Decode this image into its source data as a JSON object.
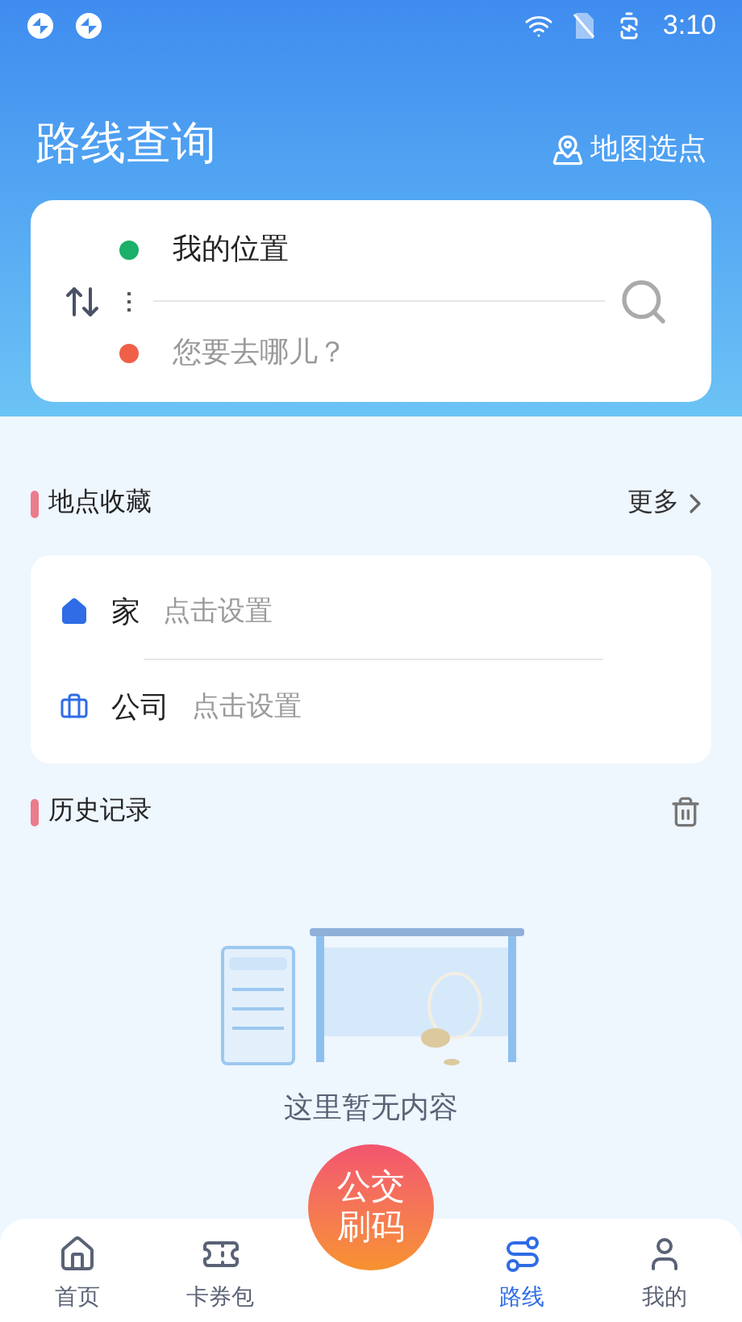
{
  "status_bar": {
    "time": "3:10"
  },
  "header": {
    "title": "路线查询",
    "map_pick": "地图选点"
  },
  "route": {
    "origin": "我的位置",
    "destination_placeholder": "您要去哪儿？"
  },
  "favorites": {
    "title": "地点收藏",
    "more": "更多",
    "items": [
      {
        "kind": "home",
        "name": "家",
        "hint": "点击设置"
      },
      {
        "kind": "work",
        "name": "公司",
        "hint": "点击设置"
      }
    ]
  },
  "history": {
    "title": "历史记录",
    "empty_text": "这里暂无内容"
  },
  "fab": {
    "label": "公交刷码"
  },
  "tabs": [
    {
      "kind": "home",
      "label": "首页",
      "selected": false
    },
    {
      "kind": "wallet",
      "label": "卡券包",
      "selected": false
    },
    {
      "kind": "route",
      "label": "路线",
      "selected": true
    },
    {
      "kind": "me",
      "label": "我的",
      "selected": false
    }
  ]
}
